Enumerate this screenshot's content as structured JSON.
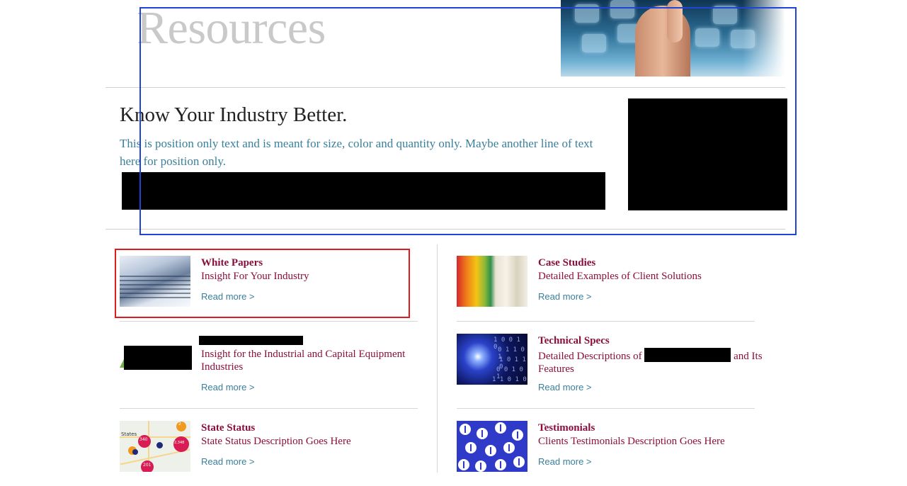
{
  "header": {
    "title": "Resources"
  },
  "intro": {
    "heading": "Know Your Industry Better.",
    "text": "This is position only text and is meant for size, color and quantity only. Maybe another line of text here for position only."
  },
  "cards": [
    {
      "title": "White Papers",
      "description": "Insight For Your Industry",
      "link": "Read more >"
    },
    {
      "title": "Case Studies",
      "description": "Detailed Examples of Client Solutions",
      "link": "Read more >"
    },
    {
      "title": "",
      "description": "Insight for the Industrial and Capital Equipment Industries",
      "link": "Read more >"
    },
    {
      "title": "Technical Specs",
      "description_start": "Detailed Descriptions of",
      "description_end": "and Its Features",
      "link": "Read more >"
    },
    {
      "title": "State Status",
      "description": "State Status Description Goes Here",
      "link": "Read more >"
    },
    {
      "title": "Testimonials",
      "description": "Clients Testimonials Description Goes Here",
      "link": "Read more >"
    }
  ],
  "map_labels": [
    "States",
    "340",
    "2,348",
    "201",
    "2"
  ],
  "colors": {
    "title_maroon": "#8a0e3c",
    "link_teal": "#3a7f9c",
    "overlay_blue": "#1f45d6",
    "highlight_red": "#e01b1b"
  }
}
